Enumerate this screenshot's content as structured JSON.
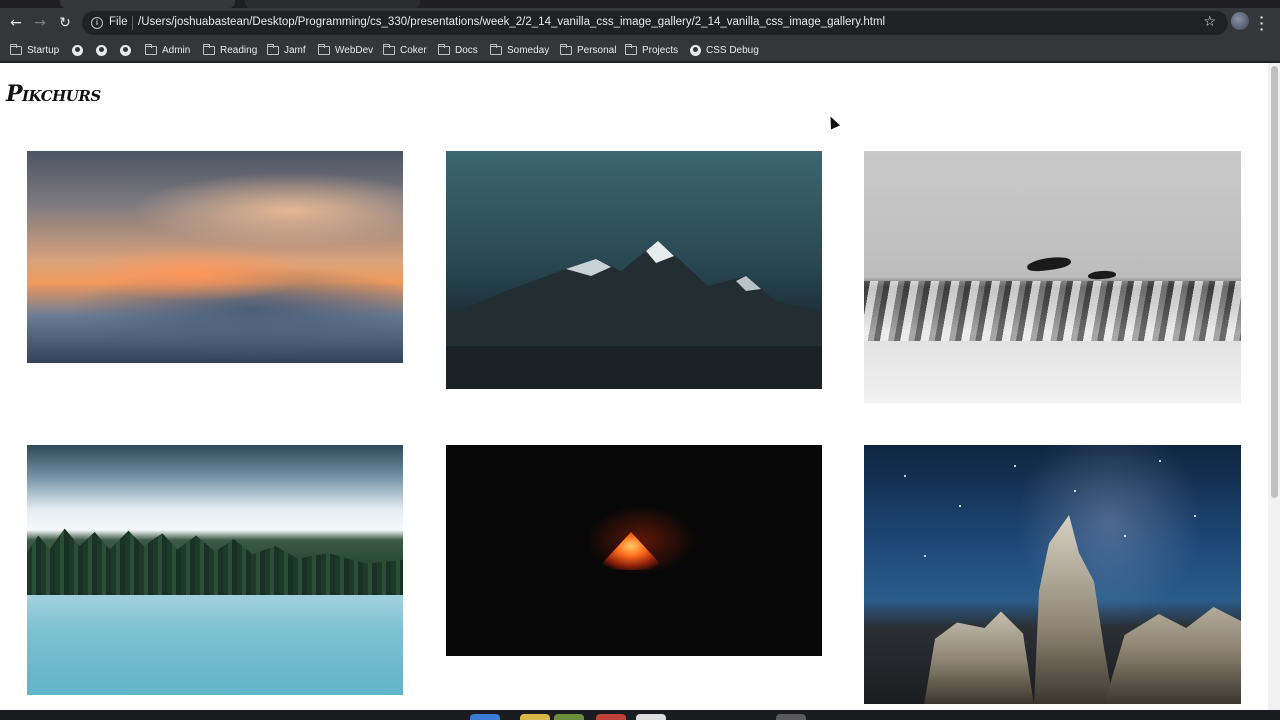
{
  "browser": {
    "scheme_label": "File",
    "url": "/Users/joshuabastean/Desktop/Programming/cs_330/presentations/week_2/2_14_vanilla_css_image_gallery/2_14_vanilla_css_image_gallery.html"
  },
  "bookmarks": {
    "items": [
      {
        "label": "Startup",
        "icon": "folder-icon"
      },
      {
        "label": "",
        "icon": "globe-icon"
      },
      {
        "label": "",
        "icon": "globe-icon"
      },
      {
        "label": "",
        "icon": "globe-icon"
      },
      {
        "label": "Admin",
        "icon": "folder-icon"
      },
      {
        "label": "Reading",
        "icon": "folder-icon"
      },
      {
        "label": "Jamf",
        "icon": "folder-icon"
      },
      {
        "label": "WebDev",
        "icon": "folder-icon"
      },
      {
        "label": "Coker",
        "icon": "folder-icon"
      },
      {
        "label": "Docs",
        "icon": "folder-icon"
      },
      {
        "label": "Someday",
        "icon": "folder-icon"
      },
      {
        "label": "Personal",
        "icon": "folder-icon"
      },
      {
        "label": "Projects",
        "icon": "folder-icon"
      },
      {
        "label": "CSS Debug",
        "icon": "globe-icon"
      }
    ]
  },
  "page": {
    "brand": "Pikchurs"
  },
  "gallery": {
    "images": [
      {
        "subject": "sunset-clouds"
      },
      {
        "subject": "snowy-mountain-peaks"
      },
      {
        "subject": "dolphins-over-waves"
      },
      {
        "subject": "misty-forest-lake"
      },
      {
        "subject": "erupting-volcano-night"
      },
      {
        "subject": "hoodoos-under-milky-way"
      }
    ]
  }
}
